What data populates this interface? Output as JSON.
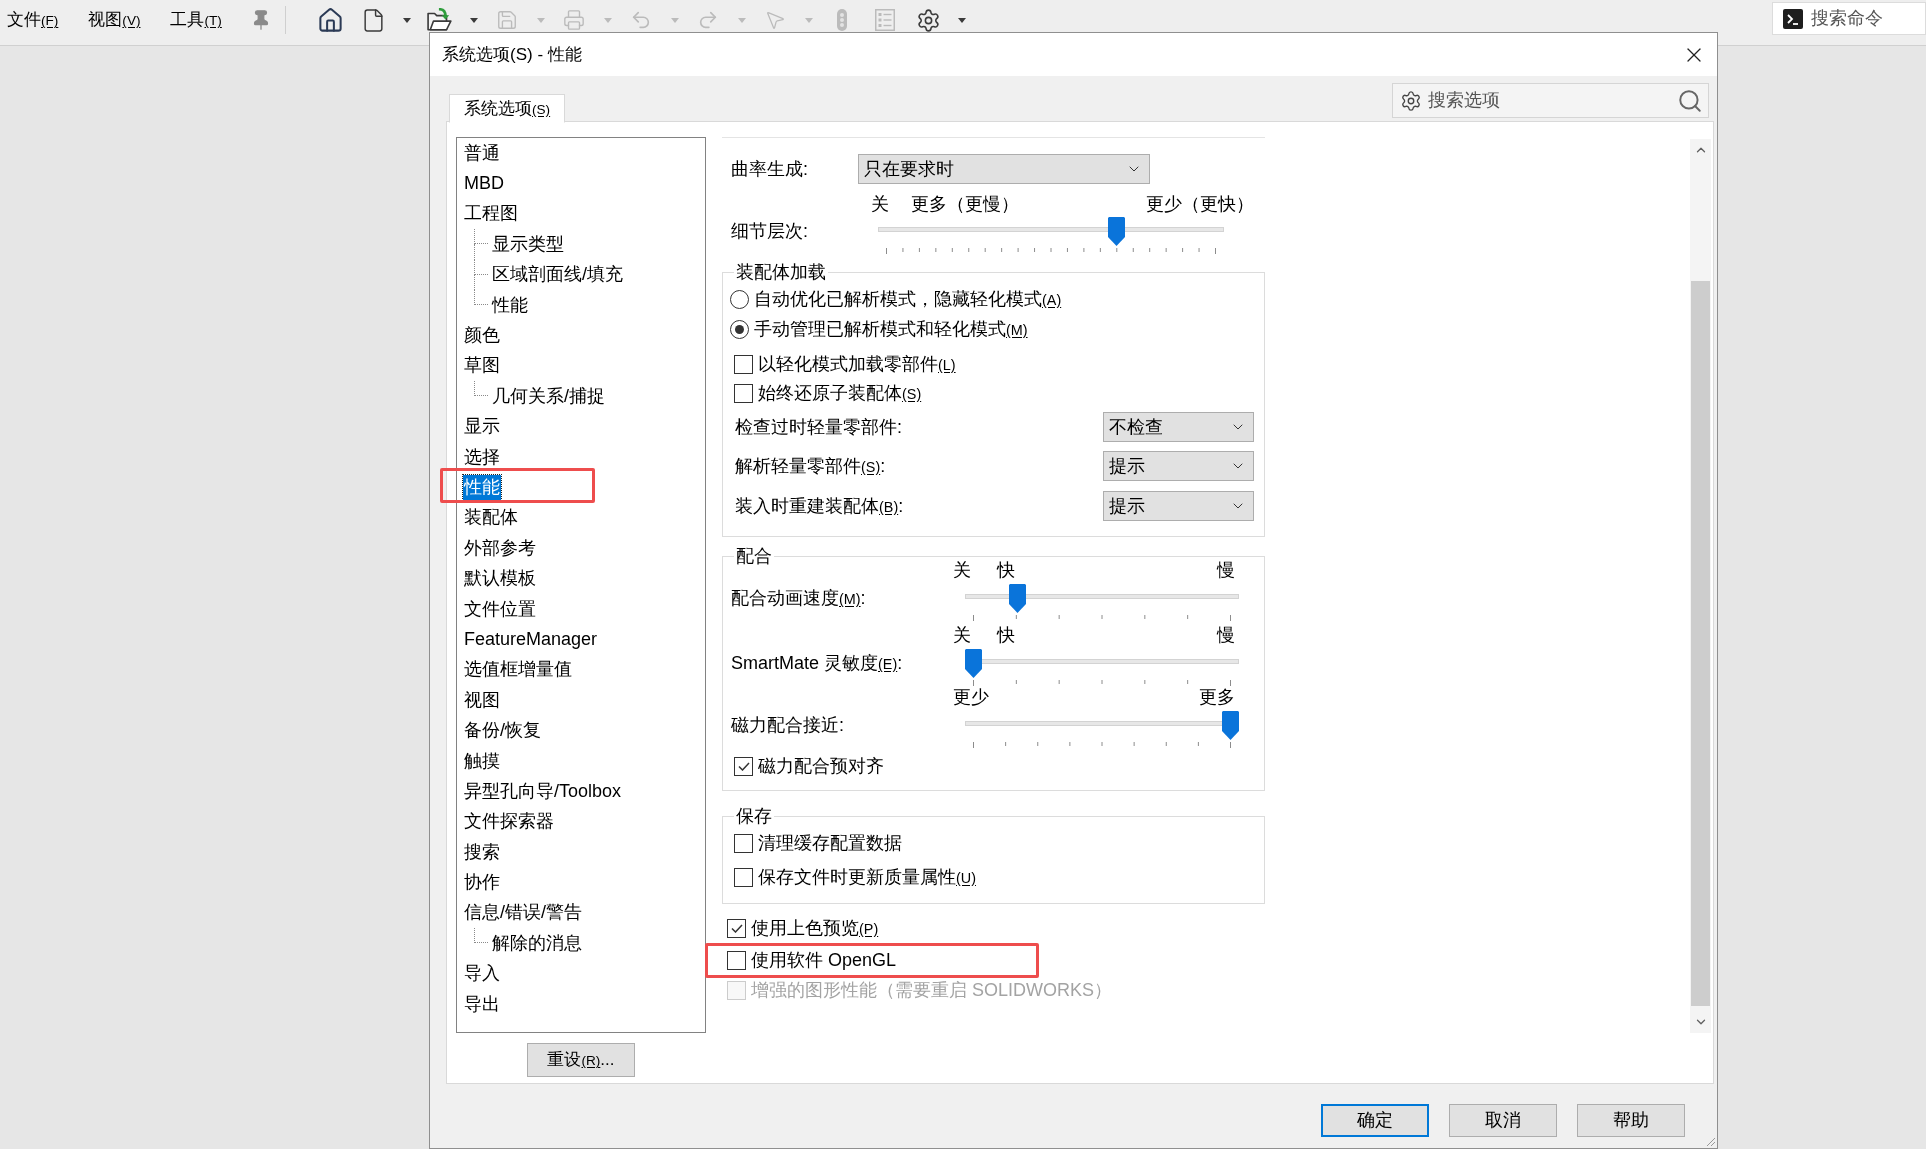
{
  "menubar": {
    "menus": [
      {
        "label": "文件",
        "accel": "(F)"
      },
      {
        "label": "视图",
        "accel": "(V)"
      },
      {
        "label": "工具",
        "accel": "(T)"
      }
    ]
  },
  "toolbar": {
    "buttons": [
      {
        "kind": "pin",
        "disabled": false,
        "menu": false
      },
      {
        "kind": "home",
        "disabled": false,
        "menu": false
      },
      {
        "kind": "new",
        "disabled": false,
        "menu": true
      },
      {
        "kind": "open",
        "disabled": false,
        "menu": true
      },
      {
        "kind": "save",
        "disabled": true,
        "menu": true
      },
      {
        "kind": "print",
        "disabled": true,
        "menu": true
      },
      {
        "kind": "undo",
        "disabled": true,
        "menu": true
      },
      {
        "kind": "redo",
        "disabled": true,
        "menu": true
      },
      {
        "kind": "select",
        "disabled": true,
        "menu": true
      },
      {
        "kind": "rebuild",
        "disabled": true,
        "menu": false
      },
      {
        "kind": "properties",
        "disabled": true,
        "menu": false
      },
      {
        "kind": "options",
        "disabled": false,
        "menu": true
      }
    ]
  },
  "command_search": {
    "placeholder": "搜索命令"
  },
  "dialog": {
    "title": "系统选项(S) - 性能",
    "tabs": [
      {
        "label": "系统选项",
        "accel": "(S)",
        "selected": true
      }
    ],
    "search": {
      "placeholder": "搜索选项"
    },
    "tree": [
      {
        "label": "普通",
        "selected": false,
        "highlighted": false
      },
      {
        "label": "MBD",
        "selected": false,
        "highlighted": false
      },
      {
        "label": "工程图",
        "selected": false,
        "highlighted": false,
        "children": [
          {
            "label": "显示类型",
            "selected": false,
            "highlighted": false
          },
          {
            "label": "区域剖面线/填充",
            "selected": false,
            "highlighted": false
          },
          {
            "label": "性能",
            "selected": false,
            "highlighted": false
          }
        ]
      },
      {
        "label": "颜色",
        "selected": false,
        "highlighted": false
      },
      {
        "label": "草图",
        "selected": false,
        "highlighted": false,
        "children": [
          {
            "label": "几何关系/捕捉",
            "selected": false,
            "highlighted": false
          }
        ]
      },
      {
        "label": "显示",
        "selected": false,
        "highlighted": false
      },
      {
        "label": "选择",
        "selected": false,
        "highlighted": false
      },
      {
        "label": "性能",
        "selected": true,
        "highlighted": true
      },
      {
        "label": "装配体",
        "selected": false,
        "highlighted": false
      },
      {
        "label": "外部参考",
        "selected": false,
        "highlighted": false
      },
      {
        "label": "默认模板",
        "selected": false,
        "highlighted": false
      },
      {
        "label": "文件位置",
        "selected": false,
        "highlighted": false
      },
      {
        "label": "FeatureManager",
        "selected": false,
        "highlighted": false
      },
      {
        "label": "选值框增量值",
        "selected": false,
        "highlighted": false
      },
      {
        "label": "视图",
        "selected": false,
        "highlighted": false
      },
      {
        "label": "备份/恢复",
        "selected": false,
        "highlighted": false
      },
      {
        "label": "触摸",
        "selected": false,
        "highlighted": false
      },
      {
        "label": "异型孔向导/Toolbox",
        "selected": false,
        "highlighted": false
      },
      {
        "label": "文件探索器",
        "selected": false,
        "highlighted": false
      },
      {
        "label": "搜索",
        "selected": false,
        "highlighted": false
      },
      {
        "label": "协作",
        "selected": false,
        "highlighted": false
      },
      {
        "label": "信息/错误/警告",
        "selected": false,
        "highlighted": false,
        "children": [
          {
            "label": "解除的消息",
            "selected": false,
            "highlighted": false
          }
        ]
      },
      {
        "label": "导入",
        "selected": false,
        "highlighted": false
      },
      {
        "label": "导出",
        "selected": false,
        "highlighted": false
      }
    ],
    "reset_button": {
      "label": "重设",
      "accel": "(R)",
      "suffix": "..."
    },
    "curvature": {
      "label": "曲率生成:",
      "value": "只在要求时"
    },
    "detail_slider": {
      "label": "细节层次:",
      "scale_start": [
        "关",
        "更多（更慢）"
      ],
      "scale_end": [
        "更少（更快）"
      ],
      "level": 0.7
    },
    "assembly_loading": {
      "title": "装配体加载",
      "modes": [
        {
          "label": "自动优化已解析模式，隐藏轻化模式",
          "accel": "(A)",
          "selected": false
        },
        {
          "label": "手动管理已解析模式和轻化模式",
          "accel": "(M)",
          "selected": true
        }
      ],
      "checkboxes": [
        {
          "label": "以轻化模式加载零部件",
          "accel": "(L)",
          "checked": false
        },
        {
          "label": "始终还原子装配体",
          "accel": "(S)",
          "checked": false
        }
      ],
      "dropdowns": [
        {
          "label": "检查过时轻量零部件:",
          "value": "不检查"
        },
        {
          "label": "解析轻量零部件",
          "accel": "(S)",
          "suffix": ":",
          "value": "提示"
        },
        {
          "label": "装入时重建装配体",
          "accel": "(B)",
          "suffix": ":",
          "value": "提示"
        }
      ]
    },
    "mates": {
      "title": "配合",
      "sliders": [
        {
          "label": "配合动画速度",
          "accel": "(M)",
          "suffix": ":",
          "scale_start": [
            "关",
            "快"
          ],
          "scale_end": [
            "慢"
          ],
          "level": 0.17
        },
        {
          "label": "SmartMate 灵敏度",
          "accel": "(E)",
          "suffix": ":",
          "scale_start": [
            "关",
            "快"
          ],
          "scale_end": [
            "慢"
          ],
          "level": 0
        },
        {
          "label": "磁力配合接近:",
          "scale_start": [
            "更少"
          ],
          "scale_end": [
            "更多"
          ],
          "level": 1
        }
      ],
      "checkboxes": [
        {
          "label": "磁力配合预对齐",
          "checked": true
        }
      ]
    },
    "save": {
      "title": "保存",
      "checkboxes": [
        {
          "label": "清理缓存配置数据",
          "checked": false
        },
        {
          "label": "保存文件时更新质量属性",
          "accel": "(U)",
          "checked": false
        }
      ]
    },
    "options": [
      {
        "label": "使用上色预览",
        "accel": "(P)",
        "checked": true,
        "disabled": false,
        "highlighted": false
      },
      {
        "label": "使用软件 OpenGL",
        "checked": false,
        "disabled": false,
        "highlighted": true
      },
      {
        "label": "增强的图形性能（需要重启 SOLIDWORKS）",
        "checked": false,
        "disabled": true,
        "highlighted": false
      }
    ],
    "buttons": [
      {
        "label": "确定",
        "default": true
      },
      {
        "label": "取消",
        "default": false
      },
      {
        "label": "帮助",
        "default": false
      }
    ]
  }
}
